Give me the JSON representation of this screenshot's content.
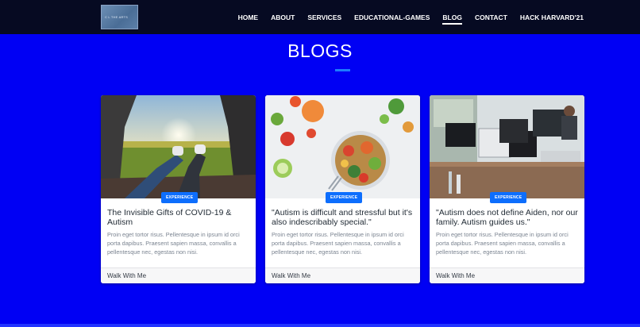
{
  "header": {
    "logo_text": "C L THE ARTS",
    "nav": [
      "HOME",
      "ABOUT",
      "SERVICES",
      "EDUCATIONAL-GAMES",
      "BLOG",
      "CONTACT",
      "HACK HARVARD'21"
    ],
    "active": "BLOG"
  },
  "page": {
    "title": "BLOGS"
  },
  "cards": [
    {
      "badge": "EXPERIENCE",
      "title": "The Invisible Gifts of COVID-19 & Autism",
      "text": "Proin eget tortor risus. Pellentesque in ipsum id orci porta dapibus. Praesent sapien massa, convallis a pellentesque nec, egestas non nisi.",
      "footer": "Walk With Me",
      "image": "people-in-car-trunk-at-sunset"
    },
    {
      "badge": "EXPERIENCE",
      "title": "\"Autism is difficult and stressful but it's also indescribably special.\"",
      "text": "Proin eget tortor risus. Pellentesque in ipsum id orci porta dapibus. Praesent sapien massa, convallis a pellentesque nec, egestas non nisi.",
      "footer": "Walk With Me",
      "image": "healthy-food-bowl"
    },
    {
      "badge": "EXPERIENCE",
      "title": "\"Autism does not define Aiden, nor our family. Autism guides us.\"",
      "text": "Proin eget tortor risus. Pellentesque in ipsum id orci porta dapibus. Praesent sapien massa, convallis a pellentesque nec, egestas non nisi.",
      "footer": "Walk With Me",
      "image": "office-workspace"
    }
  ],
  "colors": {
    "background": "#0000f4",
    "navbar": "#060a22",
    "accent": "#0d6efd"
  }
}
